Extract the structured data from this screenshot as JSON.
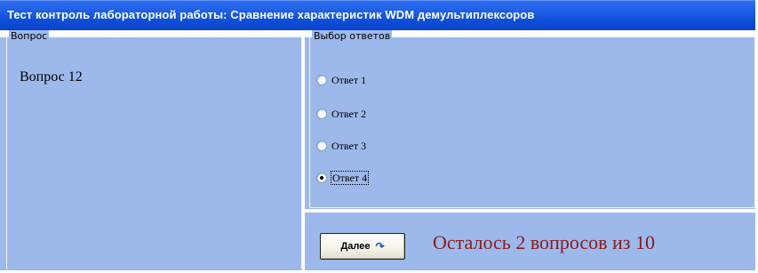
{
  "window": {
    "title": "Тест контроль лабораторной работы: Сравнение характеристик WDM демультиплексоров"
  },
  "question_group": {
    "legend": "Вопрос",
    "text": "Вопрос 12"
  },
  "answers_group": {
    "legend": "Выбор ответов",
    "options": [
      {
        "label": "Ответ 1",
        "selected": false
      },
      {
        "label": "Ответ 2",
        "selected": false
      },
      {
        "label": "Ответ 3",
        "selected": false
      },
      {
        "label": "Ответ 4",
        "selected": true
      }
    ]
  },
  "footer": {
    "next_label": "Далее",
    "next_icon": "redo-arrow-icon",
    "remaining_text": "Осталось 2 вопросов из 10"
  },
  "colors": {
    "title_bar": "#0d4dd6",
    "panel_bg": "#9db9eb",
    "remaining_text": "#8b1a1a"
  }
}
